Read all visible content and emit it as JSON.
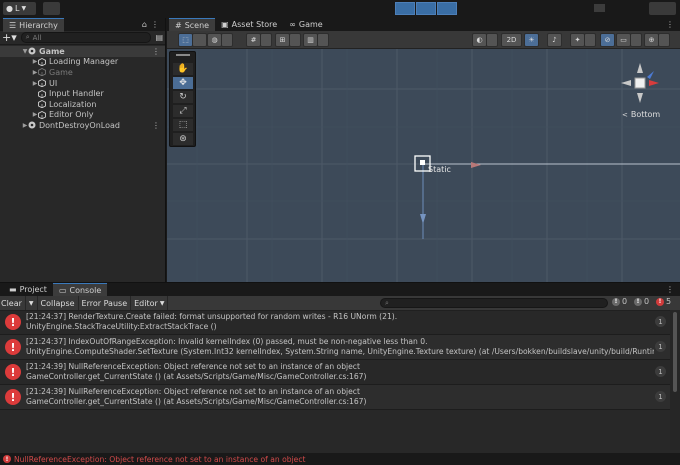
{
  "toolbar": {
    "account_label": "L"
  },
  "hierarchy": {
    "tab_label": "Hierarchy",
    "search_placeholder": "All",
    "items": [
      {
        "label": "Game",
        "depth": 0,
        "expanded": true
      },
      {
        "label": "Loading Manager",
        "depth": 1,
        "expandable": true
      },
      {
        "label": "Game",
        "depth": 1,
        "expandable": true,
        "disabled": true
      },
      {
        "label": "UI",
        "depth": 1,
        "expandable": true
      },
      {
        "label": "Input Handler",
        "depth": 1
      },
      {
        "label": "Localization",
        "depth": 1
      },
      {
        "label": "Editor Only",
        "depth": 1,
        "expandable": true
      },
      {
        "label": "DontDestroyOnLoad",
        "depth": 0
      }
    ]
  },
  "scene": {
    "tabs": [
      {
        "label": "Scene",
        "icon": "grid-icon"
      },
      {
        "label": "Asset Store",
        "icon": "shopping-bag-icon"
      },
      {
        "label": "Game",
        "icon": "gamepad-icon"
      }
    ],
    "mode_2d": "2D",
    "orientation_label": "Bottom",
    "object_label": "Static"
  },
  "console": {
    "tabs": [
      {
        "label": "Project",
        "icon": "folder-icon"
      },
      {
        "label": "Console",
        "icon": "console-icon"
      }
    ],
    "toolbar": {
      "clear": "Clear",
      "collapse": "Collapse",
      "error_pause": "Error Pause",
      "editor": "Editor"
    },
    "counts": {
      "logs": "0",
      "warnings": "0",
      "errors": "5"
    },
    "messages": [
      {
        "line1": "[21:24:37] RenderTexture.Create failed: format unsupported for random writes - R16 UNorm (21).",
        "line2": "UnityEngine.StackTraceUtility:ExtractStackTrace ()",
        "count": "1"
      },
      {
        "line1": "[21:24:37] IndexOutOfRangeException: Invalid kernelIndex (0) passed, must be non-negative less than 0.",
        "line2": "UnityEngine.ComputeShader.SetTexture (System.Int32 kernelIndex, System.String name, UnityEngine.Texture texture) (at /Users/bokken/buildslave/unity/build/Runtime/Exp",
        "count": "1"
      },
      {
        "line1": "[21:24:39] NullReferenceException: Object reference not set to an instance of an object",
        "line2": "GameController.get_CurrentState () (at Assets/Scripts/Game/Misc/GameController.cs:167)",
        "count": "1"
      },
      {
        "line1": "[21:24:39] NullReferenceException: Object reference not set to an instance of an object",
        "line2": "GameController.get_CurrentState () (at Assets/Scripts/Game/Misc/GameController.cs:167)",
        "count": "1"
      }
    ]
  },
  "status": {
    "message": "NullReferenceException: Object reference not set to an instance of an object"
  },
  "colors": {
    "error_red": "#dc3b3b",
    "selection_blue": "#3a79bb",
    "scene_bg": "#3d4a59"
  }
}
